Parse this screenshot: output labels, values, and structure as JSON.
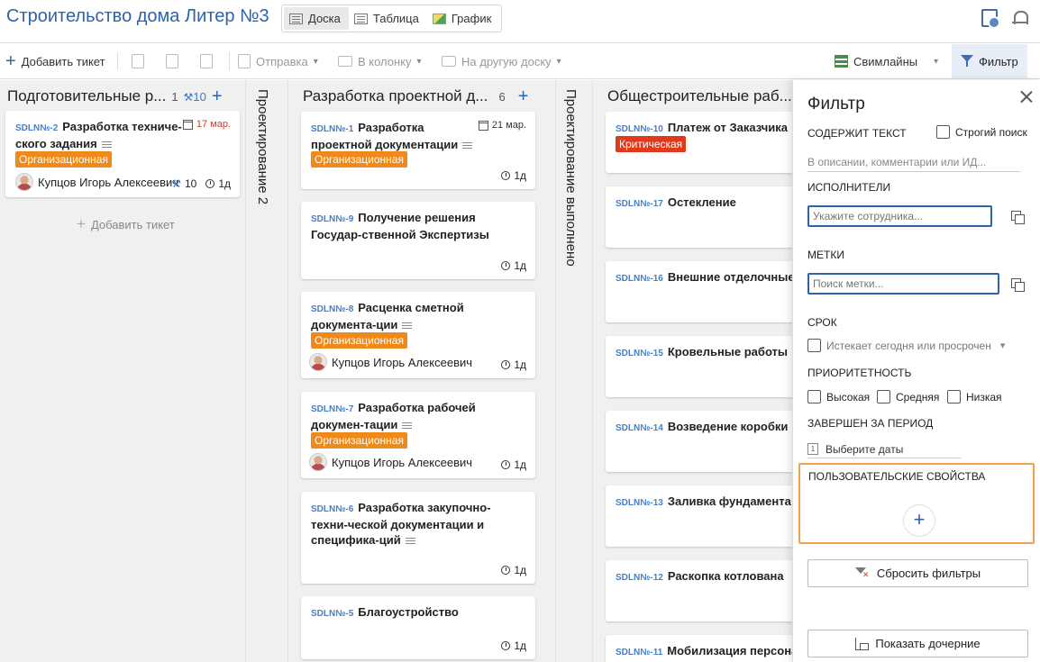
{
  "header": {
    "title": "Строительство дома Литер №3",
    "view_tabs": [
      {
        "label": "Доска",
        "icon": "board-icon",
        "active": true
      },
      {
        "label": "Таблица",
        "icon": "table-icon",
        "active": false
      },
      {
        "label": "График",
        "icon": "chart-icon",
        "active": false
      }
    ]
  },
  "toolbar": {
    "add_ticket": "Добавить тикет",
    "send": "Отправка",
    "to_column": "В колонку",
    "to_board": "На другую доску",
    "swimlanes": "Свимлайны",
    "filter": "Фильтр"
  },
  "columns": [
    {
      "title": "Подготовительные р...",
      "count": "1",
      "points": "10",
      "add_ticket": "Добавить тикет",
      "cards": [
        {
          "id": "SDLN№-2",
          "title": "Разработка техниче-ского задания",
          "date": "17 мар.",
          "tag": "Организационная",
          "assignee": "Купцов Игорь Алексеевич",
          "points": "10",
          "estimate": "1д"
        }
      ]
    },
    {
      "vertical_title": "Проектирование 2"
    },
    {
      "title": "Разработка проектной д...",
      "count": "6",
      "cards": [
        {
          "id": "SDLN№-1",
          "title": "Разработка проектной документации",
          "date": "21 мар.",
          "tag": "Организационная",
          "estimate": "1д"
        },
        {
          "id": "SDLN№-9",
          "title": "Получение решения Государ-ственной Экспертизы",
          "estimate": "1д"
        },
        {
          "id": "SDLN№-8",
          "title": "Расценка сметной документа-ции",
          "tag": "Организационная",
          "assignee": "Купцов Игорь Алексеевич",
          "estimate": "1д"
        },
        {
          "id": "SDLN№-7",
          "title": "Разработка рабочей докумен-тации",
          "tag": "Организационная",
          "assignee": "Купцов Игорь Алексеевич",
          "estimate": "1д"
        },
        {
          "id": "SDLN№-6",
          "title": "Разработка закупочно-техни-ческой документации и специфика-ций",
          "estimate": "1д"
        },
        {
          "id": "SDLN№-5",
          "title": "Благоустройство",
          "estimate": "1д"
        }
      ]
    },
    {
      "vertical_title": "Проектирование выполнено"
    },
    {
      "title": "Общестроительные раб...",
      "cards": [
        {
          "id": "SDLN№-10",
          "title": "Платеж от Заказчика",
          "tag": "Критическая"
        },
        {
          "id": "SDLN№-17",
          "title": "Остекление"
        },
        {
          "id": "SDLN№-16",
          "title": "Внешние отделочные ра"
        },
        {
          "id": "SDLN№-15",
          "title": "Кровельные работы"
        },
        {
          "id": "SDLN№-14",
          "title": "Возведение коробки"
        },
        {
          "id": "SDLN№-13",
          "title": "Заливка фундамента"
        },
        {
          "id": "SDLN№-12",
          "title": "Раскопка котлована"
        },
        {
          "id": "SDLN№-11",
          "title": "Мобилизация персонала"
        }
      ]
    }
  ],
  "filter_panel": {
    "title": "Фильтр",
    "contains_text_label": "СОДЕРЖИТ ТЕКСТ",
    "strict_search": "Строгий поиск",
    "text_placeholder": "В описании, комментарии или ИД...",
    "assignees_label": "ИСПОЛНИТЕЛИ",
    "assignee_placeholder": "Укажите сотрудника...",
    "tags_label": "МЕТКИ",
    "tags_placeholder": "Поиск метки...",
    "due_label": "СРОК",
    "due_option": "Истекает сегодня или просрочен",
    "priority_label": "ПРИОРИТЕТНОСТЬ",
    "priority_high": "Высокая",
    "priority_medium": "Средняя",
    "priority_low": "Низкая",
    "completed_label": "ЗАВЕРШЕН ЗА ПЕРИОД",
    "date_placeholder": "Выберите даты",
    "date_icon_text": "1",
    "custom_props_label": "ПОЛЬЗОВАТЕЛЬСКИЕ СВОЙСТВА",
    "add_symbol": "+",
    "reset_button": "Сбросить фильтры",
    "show_children_button": "Показать дочерние"
  }
}
